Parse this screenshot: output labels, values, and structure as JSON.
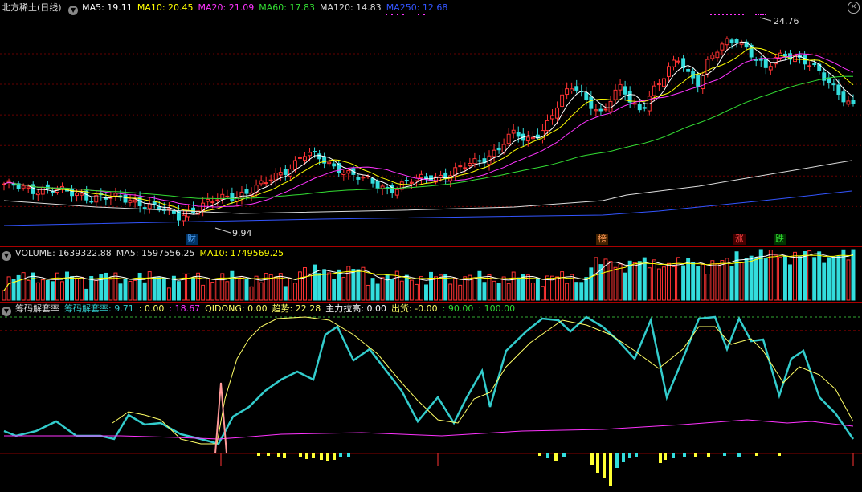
{
  "main": {
    "stock_name": "北方稀土(日线)",
    "ma_labels": [
      {
        "text": "MA5: 19.11",
        "color": "#ffffff"
      },
      {
        "text": "MA10: 20.45",
        "color": "#ffff00"
      },
      {
        "text": "MA20: 21.09",
        "color": "#ff33ff"
      },
      {
        "text": "MA60: 17.83",
        "color": "#33dd33"
      },
      {
        "text": "MA120: 14.83",
        "color": "#dddddd"
      },
      {
        "text": "MA250: 12.68",
        "color": "#3355ff"
      }
    ],
    "high_label": "24.76",
    "low_label": "9.94",
    "event_markers": [
      {
        "text": "财",
        "color": "#55aaff"
      },
      {
        "text": "榜",
        "color": "#ff9955"
      },
      {
        "text": "涨",
        "color": "#ff4444"
      },
      {
        "text": "跌",
        "color": "#33dd33"
      }
    ]
  },
  "volume": {
    "labels": [
      {
        "text": "VOLUME: 1639322.88",
        "color": "#dddddd"
      },
      {
        "text": "MA5: 1597556.25",
        "color": "#dddddd"
      },
      {
        "text": "MA10: 1749569.25",
        "color": "#ffff00"
      }
    ]
  },
  "indicator": {
    "name": "筹码解套率",
    "labels": [
      {
        "text": "筹码解套率: 9.71",
        "color": "#33cccc"
      },
      {
        "text": ": 0.00",
        "color": "#ffff66"
      },
      {
        "text": ": 18.67",
        "color": "#ff33ff"
      },
      {
        "text": "QIDONG: 0.00",
        "color": "#ffff66"
      },
      {
        "text": "趋势: 22.28",
        "color": "#ffff66"
      },
      {
        "text": "主力拉高: 0.00",
        "color": "#ffffff"
      },
      {
        "text": "出货: -0.00",
        "color": "#ffff66"
      },
      {
        "text": ": 90.00",
        "color": "#33dd33"
      },
      {
        "text": ": 100.00",
        "color": "#33dd33"
      }
    ]
  },
  "icons": {
    "collapse": "triangle-down-icon",
    "close": "close-icon"
  },
  "chart_data": {
    "type": "candlestick",
    "ylim": [
      9.0,
      26.0
    ],
    "high": 24.76,
    "low": 9.94,
    "closes_approx": [
      12.8,
      12.6,
      12.4,
      12.3,
      12.5,
      12.4,
      12.2,
      12.0,
      11.9,
      11.8,
      11.9,
      11.7,
      11.6,
      11.5,
      11.4,
      11.2,
      10.9,
      10.5,
      10.2,
      10.6,
      11.0,
      11.3,
      11.5,
      11.7,
      11.9,
      12.2,
      12.5,
      12.8,
      13.3,
      13.8,
      14.4,
      15.2,
      15.0,
      14.6,
      14.2,
      14.0,
      13.6,
      13.2,
      12.9,
      12.6,
      12.4,
      12.7,
      13.0,
      13.1,
      13.3,
      13.4,
      13.6,
      13.9,
      14.2,
      14.5,
      14.9,
      15.5,
      16.2,
      16.8,
      16.0,
      16.6,
      17.2,
      18.5,
      19.6,
      20.4,
      19.7,
      19.0,
      18.2,
      19.5,
      20.3,
      19.2,
      18.6,
      19.9,
      20.6,
      21.8,
      22.6,
      21.4,
      20.7,
      22.3,
      23.2,
      23.9,
      24.2,
      23.4,
      22.4,
      21.6,
      22.6,
      23.0,
      22.8,
      22.3,
      21.7,
      21.0,
      20.4,
      19.6,
      18.9
    ],
    "volume_ma5": 1597556.25,
    "volume_ma10": 1749569.25,
    "volume": 1639322.88
  }
}
